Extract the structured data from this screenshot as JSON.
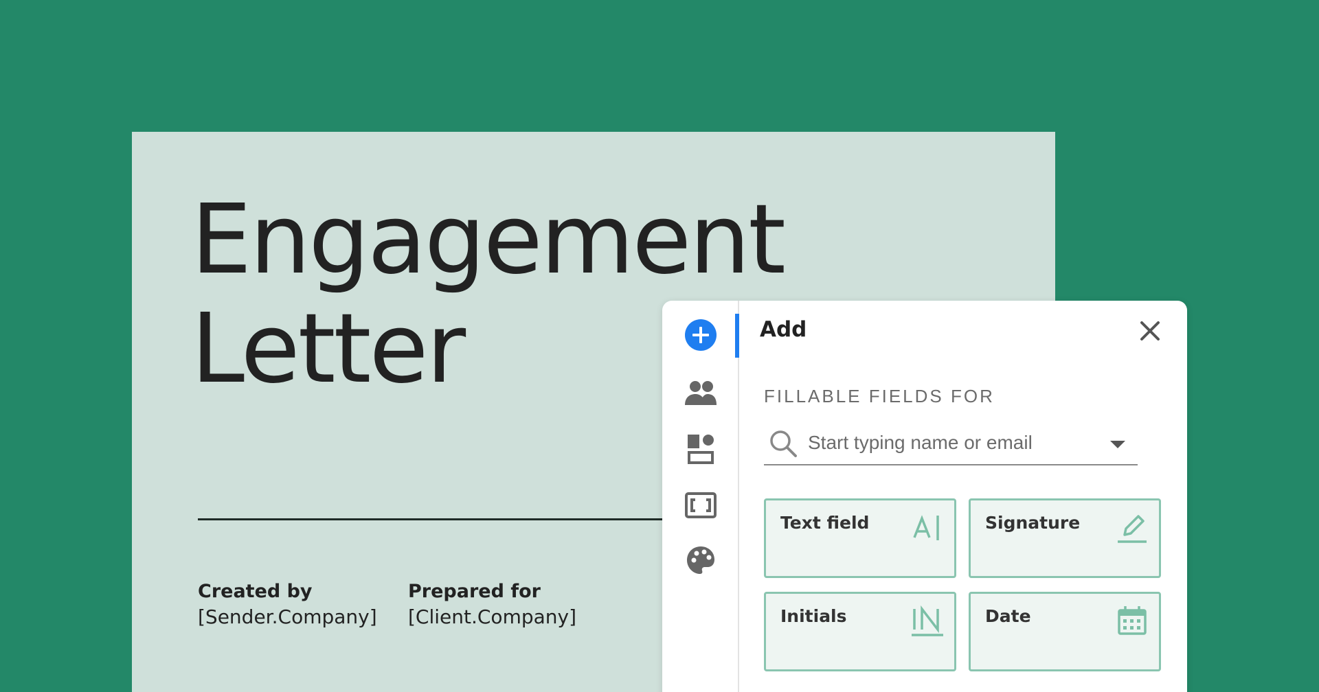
{
  "document": {
    "title_line1": "Engagement",
    "title_line2": "Letter",
    "created_by_label": "Created by",
    "created_by_value": "[Sender.Company]",
    "prepared_for_label": "Prepared for",
    "prepared_for_value": "[Client.Company]"
  },
  "panel": {
    "header": "Add",
    "section_label": "FILLABLE FIELDS FOR",
    "search_placeholder": "Start typing name or email",
    "rail_icons": [
      "add-icon",
      "people-icon",
      "blocks-icon",
      "brackets-icon",
      "palette-icon"
    ],
    "fields": [
      {
        "label": "Text field",
        "icon": "text-field-icon"
      },
      {
        "label": "Signature",
        "icon": "signature-pen-icon"
      },
      {
        "label": "Initials",
        "icon": "initials-icon"
      },
      {
        "label": "Date",
        "icon": "calendar-icon"
      }
    ]
  },
  "colors": {
    "background": "#238868",
    "page": "#cfe0da",
    "accent_blue": "#1f7ef0",
    "field_border": "#8ac5b0"
  }
}
